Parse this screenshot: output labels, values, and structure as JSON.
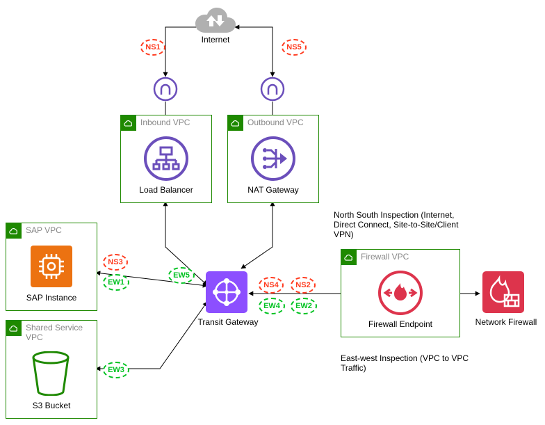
{
  "internet": {
    "label": "Internet"
  },
  "inbound": {
    "title": "Inbound VPC",
    "service": "Load Balancer"
  },
  "outbound": {
    "title": "Outbound VPC",
    "service": "NAT Gateway"
  },
  "sap": {
    "title": "SAP VPC",
    "service": "SAP Instance"
  },
  "shared": {
    "title": "Shared Service VPC",
    "service": "S3 Bucket"
  },
  "firewall": {
    "title": "Firewall VPC",
    "service": "Firewall Endpoint"
  },
  "tgw": {
    "label": "Transit Gateway"
  },
  "nfw": {
    "label": "Network Firewall"
  },
  "hops": {
    "ns1": "NS1",
    "ns2": "NS2",
    "ns3": "NS3",
    "ns4": "NS4",
    "ns5": "NS5",
    "ew1": "EW1",
    "ew2": "EW2",
    "ew3": "EW3",
    "ew4": "EW4",
    "ew5": "EW5"
  },
  "descriptions": {
    "north": "North South Inspection (Internet, Direct Connect, Site-to-Site/Client VPN)",
    "east": "East-west Inspection (VPC to VPC Traffic)"
  }
}
